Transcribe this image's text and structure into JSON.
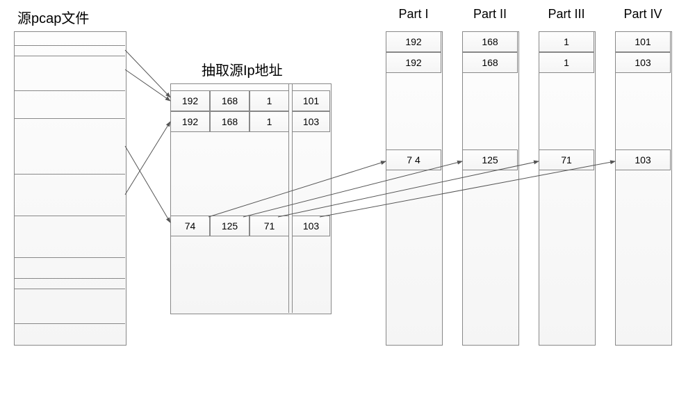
{
  "labels": {
    "source_pcap": "源pcap文件",
    "extract_ip": "抽取源Ip地址",
    "part1": "Part I",
    "part2": "Part II",
    "part3": "Part III",
    "part4": "Part IV"
  },
  "ip_table": {
    "row1": {
      "o1": "192",
      "o2": "168",
      "o3": "1",
      "o4": "101"
    },
    "row2": {
      "o1": "192",
      "o2": "168",
      "o3": "1",
      "o4": "103"
    },
    "row3": {
      "o1": "74",
      "o2": "125",
      "o3": "71",
      "o4": "103"
    }
  },
  "parts": {
    "p1": {
      "v1": "192",
      "v2": "192",
      "v3": "7 4"
    },
    "p2": {
      "v1": "168",
      "v2": "168",
      "v3": "125"
    },
    "p3": {
      "v1": "1",
      "v2": "1",
      "v3": "71"
    },
    "p4": {
      "v1": "101",
      "v2": "103",
      "v3": "103"
    }
  }
}
